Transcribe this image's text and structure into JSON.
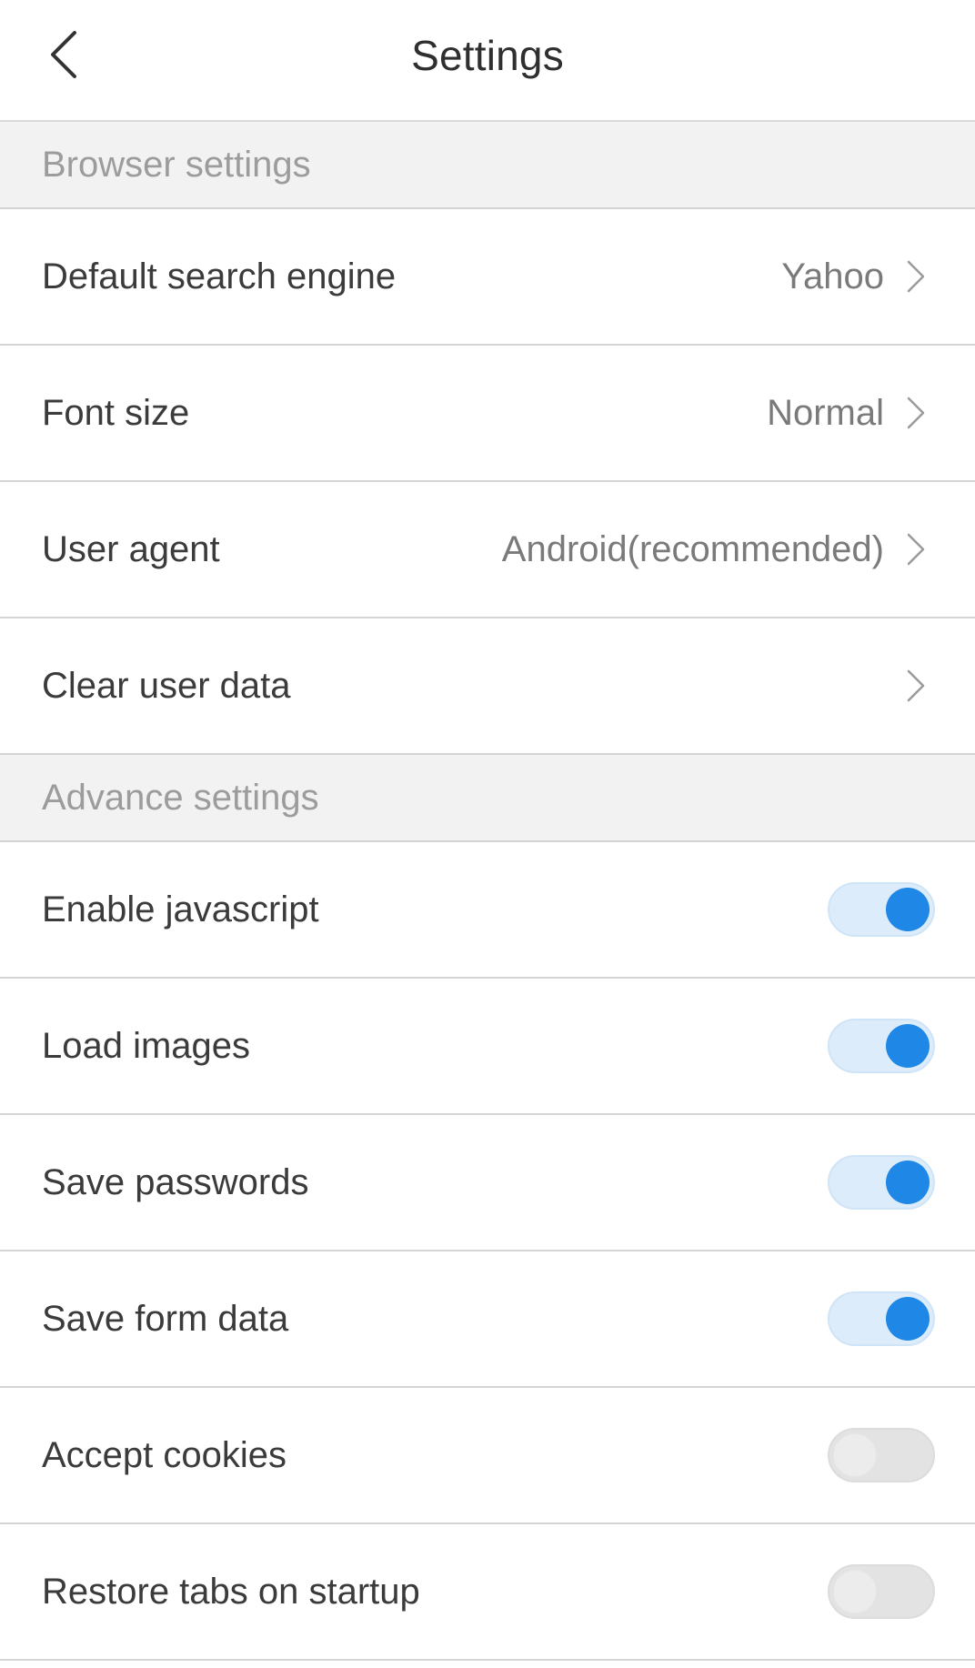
{
  "header": {
    "title": "Settings",
    "back_icon": "chevron-left-icon"
  },
  "sections": [
    {
      "title": "Browser settings",
      "rows": [
        {
          "label": "Default search engine",
          "value": "Yahoo",
          "type": "nav"
        },
        {
          "label": "Font size",
          "value": "Normal",
          "type": "nav"
        },
        {
          "label": "User agent",
          "value": "Android(recommended)",
          "type": "nav"
        },
        {
          "label": "Clear user data",
          "value": "",
          "type": "nav"
        }
      ]
    },
    {
      "title": "Advance settings",
      "rows": [
        {
          "label": "Enable javascript",
          "type": "toggle",
          "checked": true
        },
        {
          "label": "Load images",
          "type": "toggle",
          "checked": true
        },
        {
          "label": "Save passwords",
          "type": "toggle",
          "checked": true
        },
        {
          "label": "Save form data",
          "type": "toggle",
          "checked": true
        },
        {
          "label": "Accept cookies",
          "type": "toggle",
          "checked": false
        },
        {
          "label": "Restore tabs on startup",
          "type": "toggle",
          "checked": false
        }
      ]
    }
  ],
  "colors": {
    "accent": "#1f87e5",
    "toggle_track_on": "#dcecfa",
    "toggle_track_off": "#e3e3e3",
    "section_bg": "#f2f2f2"
  }
}
